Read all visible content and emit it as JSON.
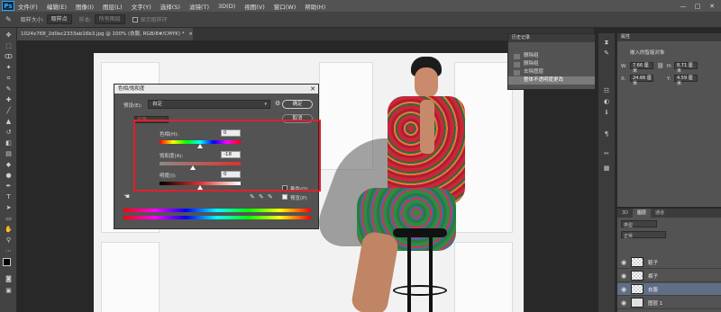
{
  "app": {
    "logo": "Ps"
  },
  "menu": [
    "文件(F)",
    "编辑(E)",
    "图像(I)",
    "图层(L)",
    "文字(Y)",
    "选择(S)",
    "滤镜(T)",
    "3D(D)",
    "视图(V)",
    "窗口(W)",
    "帮助(H)"
  ],
  "window_controls": [
    "—",
    "□",
    "✕"
  ],
  "options_bar": {
    "sample_size_label": "取样大小:",
    "sample_size_value": "取样点",
    "sample_label": "样本:",
    "sample_value": "所有图层",
    "show_ring_label": "显示取样环"
  },
  "document_tab": {
    "title": "1024x768_2d0ec2333ab16b3.jpg @ 100% (衣服, RGB/8#/CMYK) *",
    "close": "×"
  },
  "dialog": {
    "title": "色相/饱和度",
    "close": "✕",
    "preset_label": "预设(E):",
    "preset_value": "自定",
    "ok": "确定",
    "cancel": "取消",
    "channel_value": "红色",
    "hue_label": "色相(H):",
    "hue_value": "0",
    "saturation_label": "饱和度(A):",
    "saturation_value": "-18",
    "lightness_label": "明度(I):",
    "lightness_value": "0",
    "colorize_label": "着色(O)",
    "preview_label": "预览(P)",
    "hand_icon": "☚",
    "eyedroppers": [
      "✎",
      "✎",
      "✎"
    ]
  },
  "history": {
    "tabs": [
      "历史记录"
    ],
    "items": [
      {
        "label": "删除组"
      },
      {
        "label": "删除组"
      },
      {
        "label": "去除图层"
      },
      {
        "label": "整体不透明度更改",
        "selected": true
      }
    ]
  },
  "properties": {
    "tab": "属性",
    "header": "嵌入的智能对象",
    "w_label": "W:",
    "w_value": "7.66 厘米",
    "h_label": "H:",
    "h_value": "8.71 厘米",
    "x_label": "X:",
    "x_value": "24.66 厘米",
    "y_label": "Y:",
    "y_value": "4.59 厘米"
  },
  "layers": {
    "tabs": [
      "3D",
      "图层",
      "通道"
    ],
    "kind_label": "类型",
    "blend_label": "正常",
    "items": [
      {
        "name": "鞋子"
      },
      {
        "name": "裤子"
      },
      {
        "name": "衣服",
        "selected": true
      },
      {
        "name": "图层 1"
      }
    ]
  },
  "colors": {
    "accent_red": "#e0202a",
    "panel": "#535353",
    "selection": "#5f6f86"
  }
}
